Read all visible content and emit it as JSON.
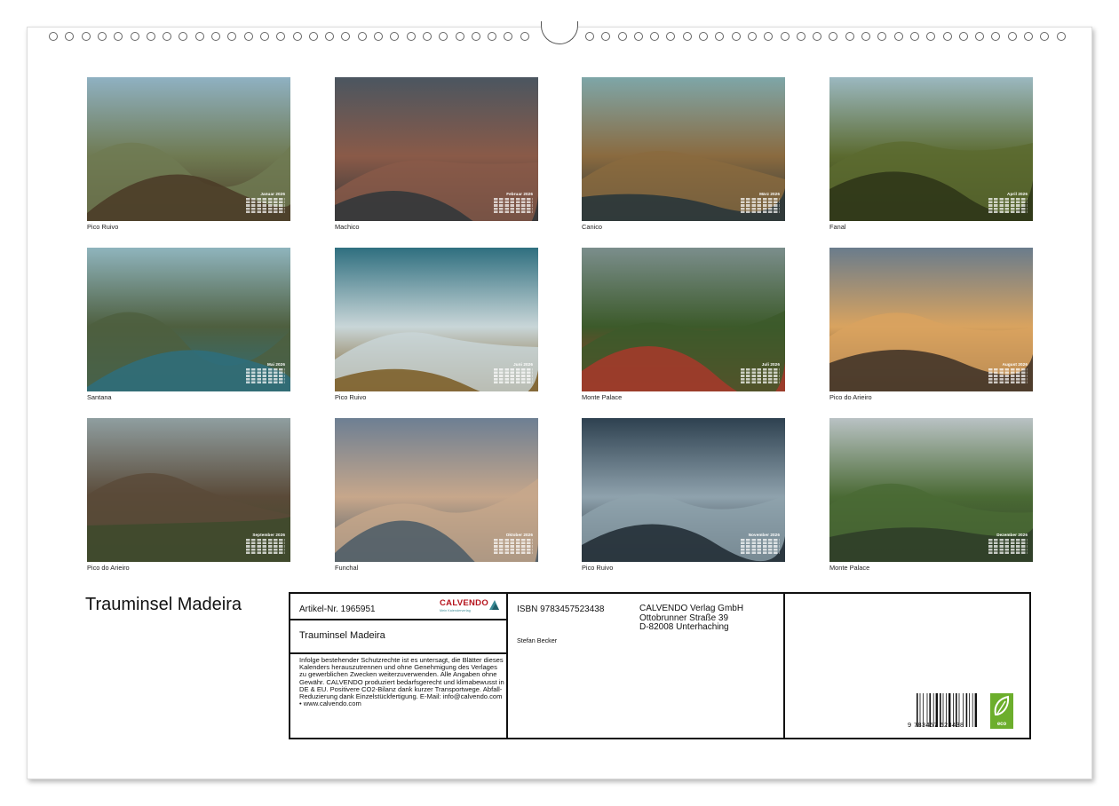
{
  "calendar_title": "Trauminsel Madeira",
  "months": [
    {
      "caption": "Pico Ruivo",
      "month_label": "Januar 2026",
      "palette": [
        "#8fb1c2",
        "#6f7a52",
        "#4a3a26"
      ]
    },
    {
      "caption": "Machico",
      "month_label": "Februar 2026",
      "palette": [
        "#4b5660",
        "#8a5a48",
        "#2f3639"
      ]
    },
    {
      "caption": "Canico",
      "month_label": "März 2026",
      "palette": [
        "#7ea6a8",
        "#8a6a3f",
        "#24343a"
      ]
    },
    {
      "caption": "Fanal",
      "month_label": "April 2026",
      "palette": [
        "#9bb8c0",
        "#5b6a2f",
        "#2d3418"
      ]
    },
    {
      "caption": "Santana",
      "month_label": "Mai 2026",
      "palette": [
        "#8fb4bd",
        "#4e5f3f",
        "#2e6f7c"
      ]
    },
    {
      "caption": "Pico Ruivo",
      "month_label": "Juni 2026",
      "palette": [
        "#2f6f7f",
        "#c9d6d8",
        "#7a5a22"
      ]
    },
    {
      "caption": "Monte Palace",
      "month_label": "Juli 2026",
      "palette": [
        "#7b8e8c",
        "#3c5a2a",
        "#a8382a"
      ]
    },
    {
      "caption": "Pico do Arieiro",
      "month_label": "August 2026",
      "palette": [
        "#6a7c8c",
        "#d9a35f",
        "#3b2f26"
      ]
    },
    {
      "caption": "Pico do Arieiro",
      "month_label": "September 2026",
      "palette": [
        "#8f9ea0",
        "#5a4a38",
        "#3d4a2c"
      ]
    },
    {
      "caption": "Funchal",
      "month_label": "Oktober 2026",
      "palette": [
        "#6d7f93",
        "#c7a78b",
        "#4a5a66"
      ]
    },
    {
      "caption": "Pico Ruivo",
      "month_label": "November 2026",
      "palette": [
        "#2e4150",
        "#8fa2ad",
        "#1d2830"
      ]
    },
    {
      "caption": "Monte Palace",
      "month_label": "Dezember 2026",
      "palette": [
        "#b9c2c4",
        "#4a6a34",
        "#2e3c28"
      ]
    }
  ],
  "info": {
    "article_number": "Artikel-Nr. 1965951",
    "brand": "CALVENDO",
    "brand_tagline": "Mein Kalenderverlag",
    "title": "Trauminsel Madeira",
    "legal_text": "Infolge bestehender Schutzrechte ist es untersagt, die Blätter dieses Kalenders herauszutrennen und ohne Genehmigung des Verlages zu gewerblichen Zwecken weiterzuverwenden. Alle Angaben ohne Gewähr. CALVENDO produziert bedarfsgerecht und klimabewusst in DE & EU. Positivere CO2-Bilanz dank kurzer Transportwege. Abfall-Reduzierung dank Einzelstückfertigung. E-Mail: info@calvendo.com • www.calvendo.com",
    "isbn": "ISBN 9783457523438",
    "author": "Stefan Becker",
    "publisher_line1": "CALVENDO Verlag GmbH",
    "publisher_line2": "Ottobrunner Straße 39",
    "publisher_line3": "D-82008 Unterhaching",
    "barcode_number": "9 783457 523438",
    "eco_label": "eco"
  }
}
